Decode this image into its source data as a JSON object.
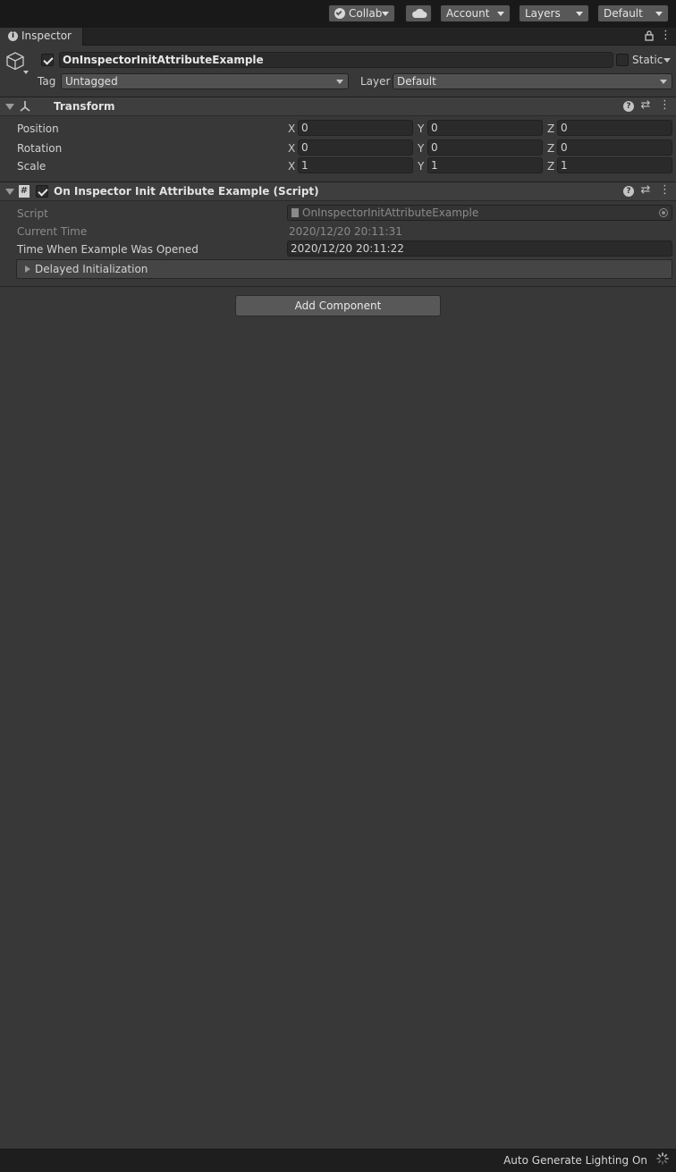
{
  "toolbar": {
    "collab": "Collab",
    "account": "Account",
    "layers": "Layers",
    "layout": "Default"
  },
  "tab": {
    "title": "Inspector"
  },
  "object": {
    "name": "OnInspectorInitAttributeExample",
    "active": true,
    "static_label": "Static",
    "tag_label": "Tag",
    "tag_value": "Untagged",
    "layer_label": "Layer",
    "layer_value": "Default"
  },
  "transform": {
    "title": "Transform",
    "rows": [
      {
        "label": "Position",
        "x": "0",
        "y": "0",
        "z": "0"
      },
      {
        "label": "Rotation",
        "x": "0",
        "y": "0",
        "z": "0"
      },
      {
        "label": "Scale",
        "x": "1",
        "y": "1",
        "z": "1"
      }
    ],
    "axis": {
      "x": "X",
      "y": "Y",
      "z": "Z"
    }
  },
  "script_component": {
    "title": "On Inspector Init Attribute Example (Script)",
    "enabled": true,
    "script_label": "Script",
    "script_value": "OnInspectorInitAttributeExample",
    "current_time_label": "Current Time",
    "current_time_value": "2020/12/20 20:11:31",
    "opened_label": "Time When Example Was Opened",
    "opened_value": "2020/12/20 20:11:22",
    "foldout_label": "Delayed Initialization"
  },
  "add_component": "Add Component",
  "status": {
    "text": "Auto Generate Lighting On"
  },
  "colors": {
    "background": "#383838",
    "toolbar": "#191919",
    "field": "#2a2a2a",
    "button": "#585858"
  }
}
